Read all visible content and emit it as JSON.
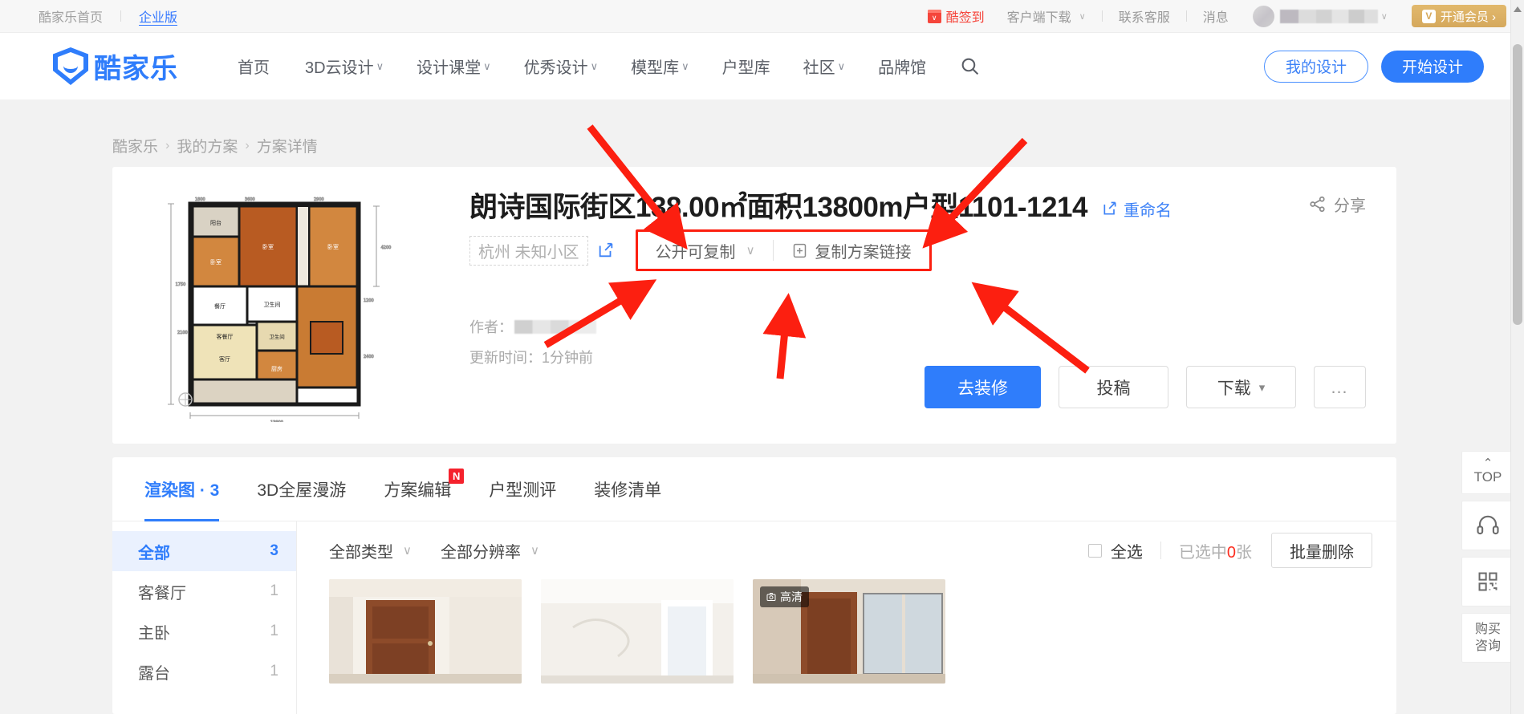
{
  "topbar": {
    "home_label": "酷家乐首页",
    "enterprise_label": "企业版",
    "signin_label": "酷签到",
    "client_download_label": "客户端下载",
    "contact_label": "联系客服",
    "message_label": "消息",
    "vip_label": "开通会员 ›",
    "vip_icon_letter": "V",
    "caret": "∨"
  },
  "nav": {
    "logo_text": "酷家乐",
    "items": [
      {
        "label": "首页",
        "caret": ""
      },
      {
        "label": "3D云设计",
        "caret": "∨"
      },
      {
        "label": "设计课堂",
        "caret": "∨"
      },
      {
        "label": "优秀设计",
        "caret": "∨"
      },
      {
        "label": "模型库",
        "caret": "∨"
      },
      {
        "label": "户型库",
        "caret": ""
      },
      {
        "label": "社区",
        "caret": "∨"
      },
      {
        "label": "品牌馆",
        "caret": ""
      }
    ],
    "my_design_label": "我的设计",
    "start_design_label": "开始设计"
  },
  "breadcrumb": {
    "items": [
      "酷家乐",
      "我的方案",
      "方案详情"
    ],
    "separator": "›"
  },
  "plan": {
    "title": "朗诗国际街区138.00㎡面积13800m户型1101-1214",
    "rename_label": "重命名",
    "share_label": "分享",
    "community": "杭州 未知小区",
    "permission_label": "公开可复制",
    "permission_caret": "∨",
    "copy_link_label": "复制方案链接",
    "author_label": "作者：",
    "updated_label": "更新时间：1分钟前",
    "buttons": {
      "decorate": "去装修",
      "submit": "投稿",
      "download": "下载",
      "download_caret": "▾",
      "more": "…"
    }
  },
  "panel": {
    "tabs": [
      {
        "label": "渲染图 · 3",
        "badge": ""
      },
      {
        "label": "3D全屋漫游",
        "badge": ""
      },
      {
        "label": "方案编辑",
        "badge": "N"
      },
      {
        "label": "户型测评",
        "badge": ""
      },
      {
        "label": "装修清单",
        "badge": ""
      }
    ],
    "active_tab_index": 0,
    "sidebar": [
      {
        "label": "全部",
        "count": "3"
      },
      {
        "label": "客餐厅",
        "count": "1"
      },
      {
        "label": "主卧",
        "count": "1"
      },
      {
        "label": "露台",
        "count": "1"
      }
    ],
    "filters": [
      {
        "label": "全部类型",
        "caret": "∨"
      },
      {
        "label": "全部分辨率",
        "caret": "∨"
      }
    ],
    "select_all_label": "全选",
    "selected_prefix": "已选中",
    "selected_count": "0",
    "selected_suffix": "张",
    "batch_delete_label": "批量删除",
    "hd_badge_label": "高清"
  },
  "dock": {
    "top_label": "TOP",
    "top_caret": "⌃",
    "service_icon": "headset-icon",
    "qr_icon": "qrcode-icon",
    "purchase_line1": "购买",
    "purchase_line2": "咨询"
  },
  "floorplan": {
    "rooms": [
      "阳台",
      "卧室",
      "卧室",
      "卧室",
      "餐厅",
      "卫生间",
      "客餐厅",
      "卫生间",
      "客厅",
      "厨房"
    ]
  },
  "colors": {
    "brand": "#2f7dfb",
    "annotation": "#fc1f10",
    "vip": "#d5a85c",
    "alert": "#f5453b"
  }
}
